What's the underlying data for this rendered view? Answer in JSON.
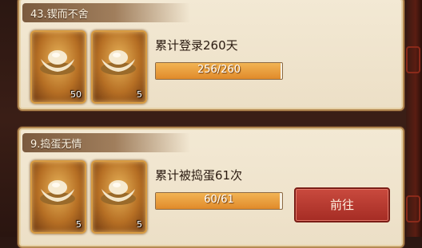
{
  "tasks": [
    {
      "title": "43.锲而不舍",
      "description": "累计登录260天",
      "progress_text": "256/260",
      "progress_fraction": 0.985,
      "rewards": [
        {
          "icon": "gold-ingot-icon",
          "qty": "50"
        },
        {
          "icon": "gold-ingot-icon",
          "qty": "5"
        }
      ]
    },
    {
      "title": "9.捣蛋无情",
      "description": "累计被捣蛋61次",
      "progress_text": "60/61",
      "progress_fraction": 0.984,
      "rewards": [
        {
          "icon": "gold-ingot-icon",
          "qty": "5"
        },
        {
          "icon": "gold-ingot-icon",
          "qty": "5"
        }
      ],
      "action_label": "前往"
    }
  ]
}
